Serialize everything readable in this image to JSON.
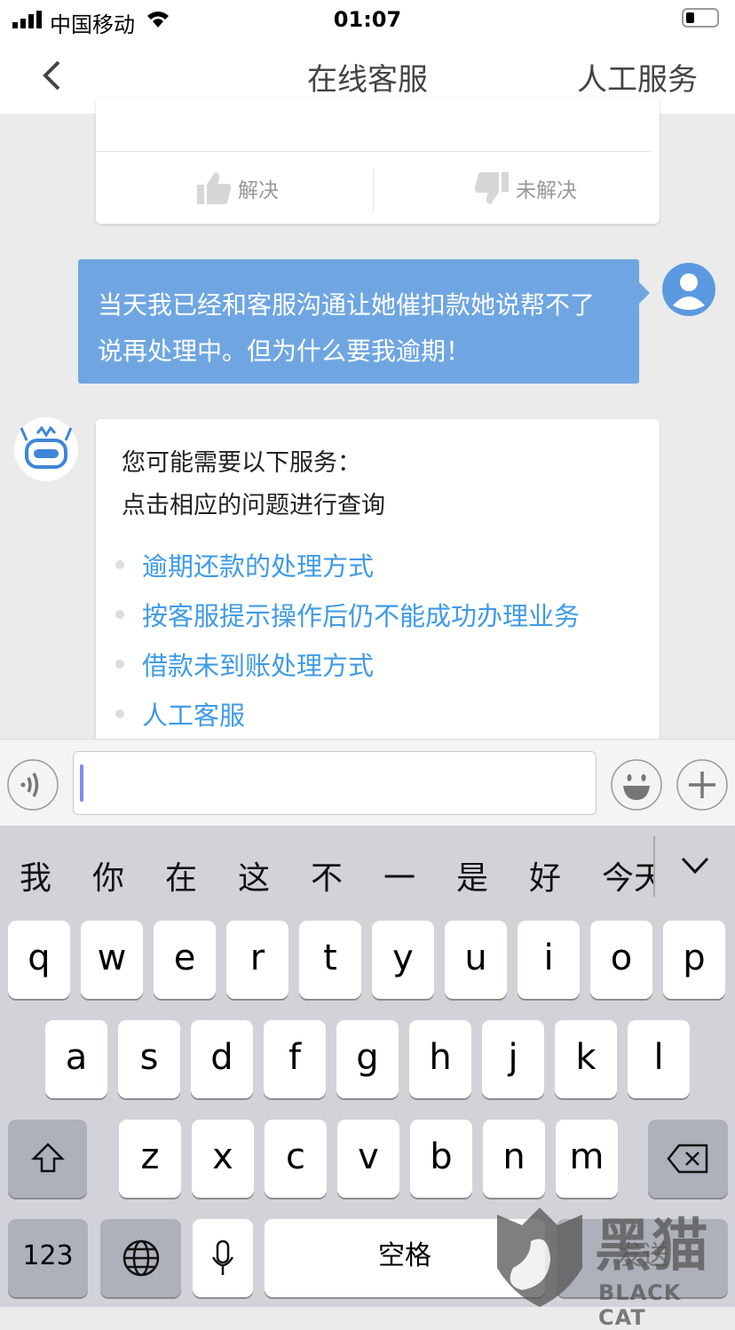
{
  "status_bar": {
    "carrier": "中国移动",
    "time": "01:07"
  },
  "nav": {
    "title": "在线客服",
    "right_action": "人工服务"
  },
  "feedback": {
    "solved": "解决",
    "unsolved": "未解决"
  },
  "user_message": {
    "text": "当天我已经和客服沟通让她催扣款她说帮不了 说再处理中。但为什么要我逾期！"
  },
  "bot_message": {
    "line1": "您可能需要以下服务：",
    "line2": "点击相应的问题进行查询",
    "links": [
      "逾期还款的处理方式",
      "按客服提示操作后仍不能成功办理业务",
      "借款未到账处理方式",
      "人工客服"
    ]
  },
  "input": {
    "value": ""
  },
  "keyboard": {
    "candidates": [
      "我",
      "你",
      "在",
      "这",
      "不",
      "一",
      "是",
      "好",
      "今天"
    ],
    "row1": [
      "q",
      "w",
      "e",
      "r",
      "t",
      "y",
      "u",
      "i",
      "o",
      "p"
    ],
    "row2": [
      "a",
      "s",
      "d",
      "f",
      "g",
      "h",
      "j",
      "k",
      "l"
    ],
    "row3": [
      "z",
      "x",
      "c",
      "v",
      "b",
      "n",
      "m"
    ],
    "numbers": "123",
    "space": "空格",
    "return": "发送"
  },
  "watermark": {
    "brand": "黑猫",
    "brand_en": "BLACK CAT"
  },
  "colors": {
    "accent": "#3f9be6",
    "user_bubble": "#6fa6e2"
  }
}
